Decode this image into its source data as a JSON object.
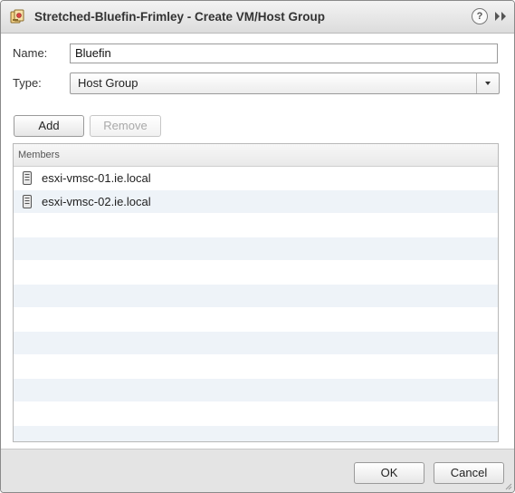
{
  "window": {
    "title": "Stretched-Bluefin-Frimley - Create VM/Host Group",
    "title_icon": "cluster-group-icon",
    "help_label": "?",
    "help_icon": "help-icon",
    "expand_icon": "expand-icon"
  },
  "form": {
    "name_label": "Name:",
    "name_value": "Bluefin",
    "type_label": "Type:",
    "type_value": "Host Group"
  },
  "buttons": {
    "add": "Add",
    "remove": "Remove",
    "ok": "OK",
    "cancel": "Cancel"
  },
  "members": {
    "header": "Members",
    "items": [
      {
        "name": "esxi-vmsc-01.ie.local",
        "icon": "host-icon"
      },
      {
        "name": "esxi-vmsc-02.ie.local",
        "icon": "host-icon"
      }
    ],
    "empty_rows": 10
  },
  "colors": {
    "row_alt": "#eef3f8",
    "footer": "#e4e4e4",
    "titlebar": "#dcdcdc"
  }
}
